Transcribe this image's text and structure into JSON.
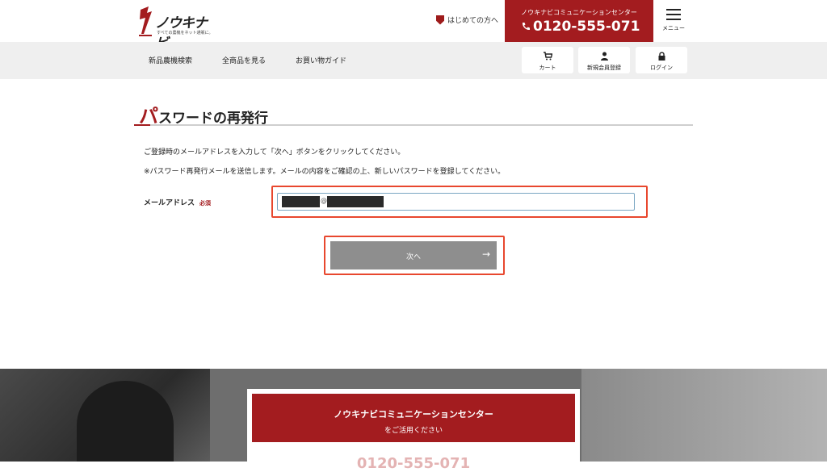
{
  "header": {
    "logo_text": "ノウキナビ",
    "logo_tagline": "すべての農機をネット通販に。",
    "first_time_link": "はじめての方へ",
    "call_center_caption": "ノウキナビコミュニケーションセンター",
    "phone": "0120-555-071",
    "menu_label": "メニュー"
  },
  "nav": {
    "items": [
      "新品農機検索",
      "全商品を見る",
      "お買い物ガイド"
    ],
    "cart_label": "カート",
    "register_label": "新規会員登録",
    "login_label": "ログイン"
  },
  "page": {
    "title_first": "パ",
    "title_rest": "スワードの再発行",
    "desc1": "ご登録時のメールアドレスを入力して「次へ」ボタンをクリックしてください。",
    "desc2": "※パスワード再発行メールを送信します。メールの内容をご確認の上、新しいパスワードを登録してください。",
    "email_label": "メールアドレス",
    "required_badge": "必須",
    "email_at": "@",
    "next_button": "次へ",
    "next_arrow": "→"
  },
  "footer": {
    "banner_line1": "ノウキナビコミュニケーションセンター",
    "banner_line2": "をご活用ください",
    "phone": "0120-555-071"
  },
  "colors": {
    "brand_red": "#a31c1f",
    "highlight": "#e8472e",
    "button_gray": "#8e8e8e"
  }
}
